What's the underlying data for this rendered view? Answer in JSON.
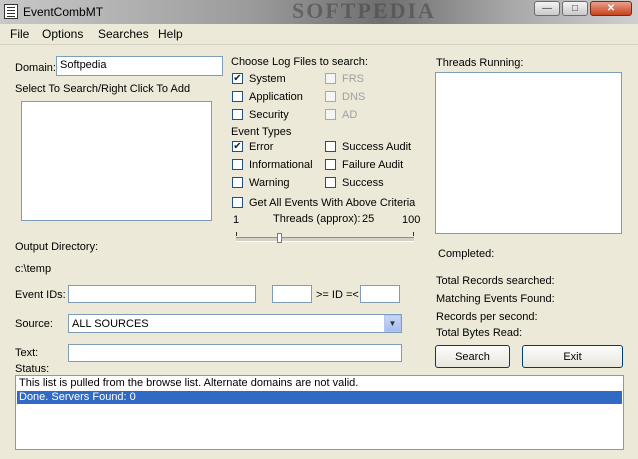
{
  "window": {
    "title": "EventCombMT",
    "watermark": "SOFTPEDIA"
  },
  "menu": [
    "File",
    "Options",
    "Searches",
    "Help"
  ],
  "domain": {
    "label": "Domain:",
    "value": "Softpedia"
  },
  "select_label": "Select To Search/Right Click To Add",
  "log_files": {
    "label": "Choose Log Files to search:",
    "items": [
      {
        "label": "System",
        "checked": true,
        "enabled": true
      },
      {
        "label": "Application",
        "checked": false,
        "enabled": true
      },
      {
        "label": "Security",
        "checked": false,
        "enabled": true
      },
      {
        "label": "FRS",
        "checked": false,
        "enabled": false
      },
      {
        "label": "DNS",
        "checked": false,
        "enabled": false
      },
      {
        "label": "AD",
        "checked": false,
        "enabled": false
      }
    ]
  },
  "event_types": {
    "label": "Event Types",
    "items": [
      {
        "label": "Error",
        "checked": true
      },
      {
        "label": "Informational",
        "checked": false
      },
      {
        "label": "Warning",
        "checked": false
      },
      {
        "label": "Success Audit",
        "checked": false
      },
      {
        "label": "Failure Audit",
        "checked": false
      },
      {
        "label": "Success",
        "checked": false
      }
    ]
  },
  "get_all_events": {
    "label": "Get All Events With Above Criteria",
    "checked": false
  },
  "threads": {
    "min": "1",
    "max": "100",
    "label": "Threads (approx):",
    "value": "25",
    "position": 0.24
  },
  "threads_running_label": "Threads Running:",
  "output_directory": {
    "label": "Output Directory:",
    "value": "c:\\temp"
  },
  "event_ids": {
    "label": "Event IDs:",
    "value": "",
    "range_label": ">= ID =<",
    "min": "",
    "max": ""
  },
  "source": {
    "label": "Source:",
    "value": "ALL SOURCES"
  },
  "text_field": {
    "label": "Text:",
    "value": ""
  },
  "stats": {
    "completed": "Completed:",
    "total_records": "Total Records searched:",
    "matching": "Matching Events Found:",
    "records_per_second": "Records per second:",
    "total_bytes": "Total Bytes Read:"
  },
  "buttons": {
    "search": "Search",
    "exit": "Exit"
  },
  "status": {
    "label": "Status:",
    "lines": [
      "This list is pulled from the browse list. Alternate domains are not valid.",
      "Done. Servers Found: 0"
    ],
    "selected_index": 1
  },
  "colors": {
    "selection": "#316ac5",
    "window_bg": "#ece9d8"
  }
}
